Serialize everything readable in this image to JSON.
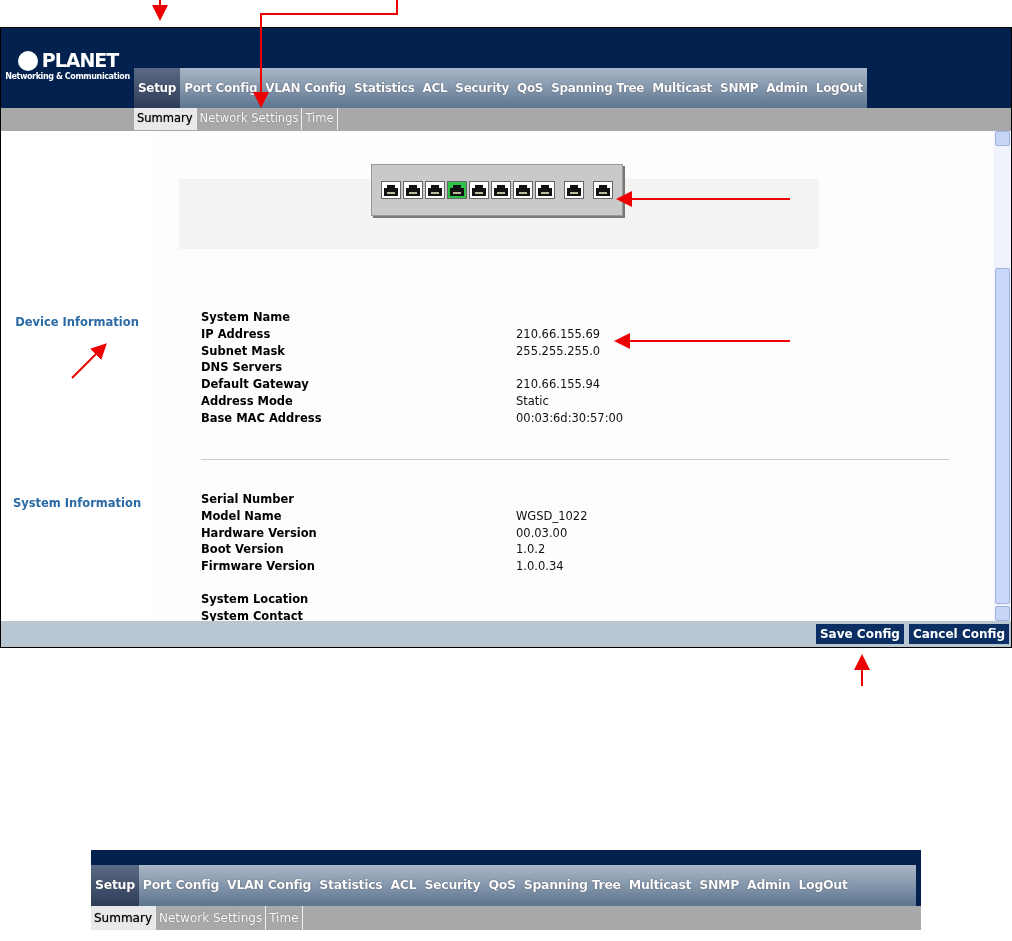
{
  "screenshot": {
    "logo": {
      "name": "PLANET",
      "tagline": "Networking & Communication"
    },
    "menu": [
      {
        "label": "Setup",
        "selected": true
      },
      {
        "label": "Port Config",
        "selected": false
      },
      {
        "label": "VLAN Config",
        "selected": false
      },
      {
        "label": "Statistics",
        "selected": false
      },
      {
        "label": "ACL",
        "selected": false
      },
      {
        "label": "Security",
        "selected": false
      },
      {
        "label": "QoS",
        "selected": false
      },
      {
        "label": "Spanning Tree",
        "selected": false
      },
      {
        "label": "Multicast",
        "selected": false
      },
      {
        "label": "SNMP",
        "selected": false
      },
      {
        "label": "Admin",
        "selected": false
      },
      {
        "label": "LogOut",
        "selected": false
      }
    ],
    "submenu": [
      {
        "label": "Summary",
        "selected": true
      },
      {
        "label": "Network Settings",
        "selected": false
      },
      {
        "label": "Time",
        "selected": false
      }
    ],
    "port_groups": [
      {
        "ports": [
          {
            "active": false
          },
          {
            "active": false
          },
          {
            "active": false
          },
          {
            "active": true
          },
          {
            "active": false
          },
          {
            "active": false
          },
          {
            "active": false
          },
          {
            "active": false
          }
        ]
      },
      {
        "ports": [
          {
            "active": false
          }
        ]
      },
      {
        "ports": [
          {
            "active": false
          }
        ]
      }
    ],
    "sections": [
      {
        "title": "Device Information",
        "rows": [
          {
            "label": "System Name"
          },
          {
            "label": "IP Address",
            "value": "210.66.155.69"
          },
          {
            "label": "Subnet Mask",
            "value": "255.255.255.0"
          },
          {
            "label": "DNS Servers"
          },
          {
            "label": "Default Gateway",
            "value": "210.66.155.94"
          },
          {
            "label": "Address Mode",
            "value": "Static"
          },
          {
            "label": "Base MAC Address",
            "value": "00:03:6d:30:57:00"
          }
        ]
      },
      {
        "title": "System Information",
        "rows": [
          {
            "label": "Serial Number"
          },
          {
            "label": "Model Name",
            "value": "WGSD_1022"
          },
          {
            "label": "Hardware Version",
            "value": "00.03.00"
          },
          {
            "label": "Boot Version",
            "value": "1.0.2"
          },
          {
            "label": "Firmware Version",
            "value": "1.0.0.34"
          },
          {
            "label": "System Location",
            "gap": true
          },
          {
            "label": "System Contact"
          }
        ]
      }
    ],
    "buttons": [
      "Save Config",
      "Cancel Config"
    ]
  },
  "detail": {
    "menu": [
      {
        "label": "Setup",
        "selected": true
      },
      {
        "label": "Port Config",
        "selected": false
      },
      {
        "label": "VLAN Config",
        "selected": false
      },
      {
        "label": "Statistics",
        "selected": false
      },
      {
        "label": "ACL",
        "selected": false
      },
      {
        "label": "Security",
        "selected": false
      },
      {
        "label": "QoS",
        "selected": false
      },
      {
        "label": "Spanning Tree",
        "selected": false
      },
      {
        "label": "Multicast",
        "selected": false
      },
      {
        "label": "SNMP",
        "selected": false
      },
      {
        "label": "Admin",
        "selected": false
      },
      {
        "label": "LogOut",
        "selected": false
      }
    ],
    "submenu": [
      {
        "label": "Summary",
        "selected": true
      },
      {
        "label": "Network Settings",
        "selected": false
      },
      {
        "label": "Time",
        "selected": false
      }
    ]
  }
}
